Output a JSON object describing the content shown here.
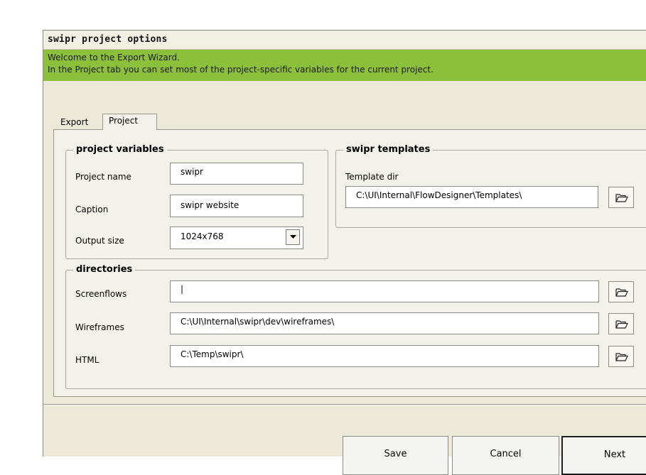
{
  "window": {
    "title": "swipr project options"
  },
  "banner": {
    "line1": "Welcome to the Export Wizard.",
    "line2": "In the Project tab you can set most of the project-specific variables for the current project.",
    "color": "#8dc03a"
  },
  "tabs": [
    {
      "label": "Export",
      "active": false
    },
    {
      "label": "Project",
      "active": true
    }
  ],
  "project_variables": {
    "legend": "project variables",
    "project_name": {
      "label": "Project name",
      "value": "swipr"
    },
    "caption": {
      "label": "Caption",
      "value": "swipr website"
    },
    "output_size": {
      "label": "Output size",
      "value": "1024x768"
    }
  },
  "templates": {
    "legend": "swipr templates",
    "dir_label": "Template dir",
    "dir_value": "C:\\UI\\Internal\\FlowDesigner\\Templates\\"
  },
  "directories": {
    "legend": "directories",
    "screenflows": {
      "label": "Screenflows",
      "value": "|"
    },
    "wireframes": {
      "label": "Wireframes",
      "value": "C:\\UI\\Internal\\swipr\\dev\\wireframes\\"
    },
    "html": {
      "label": "HTML",
      "value": "C:\\Temp\\swipr\\"
    }
  },
  "buttons": {
    "save": "Save",
    "cancel": "Cancel",
    "next": "Next"
  },
  "icons": {
    "browse": "folder-open-icon",
    "dropdown": "chevron-down-icon"
  }
}
